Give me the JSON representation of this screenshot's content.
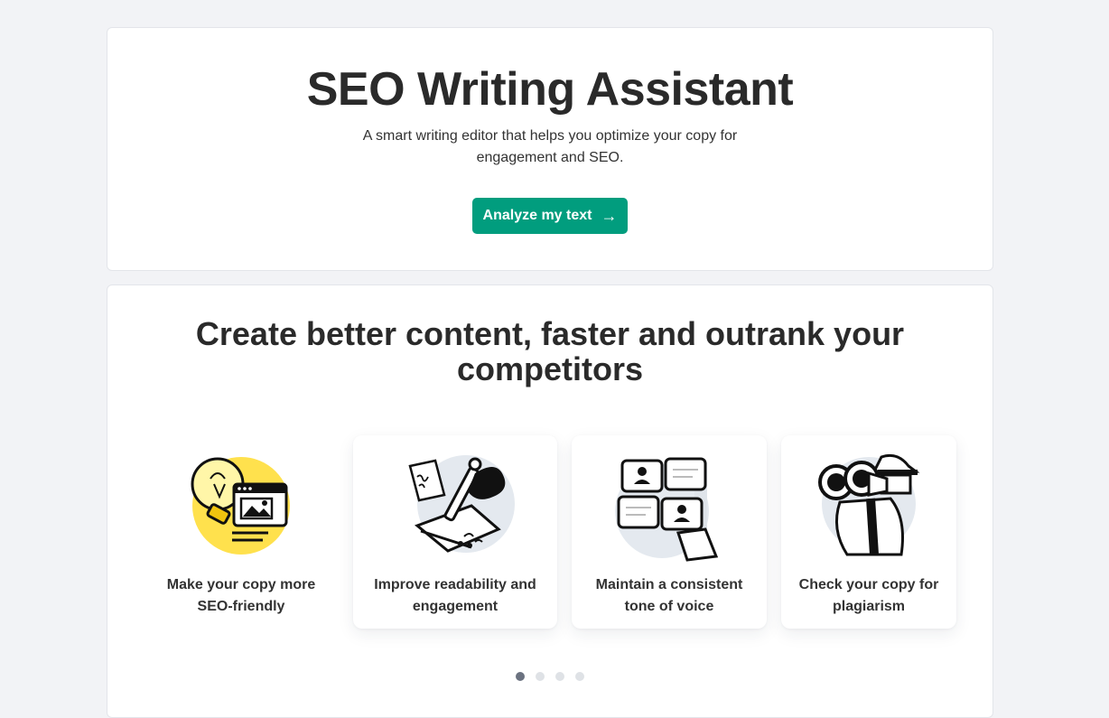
{
  "hero": {
    "title": "SEO Writing Assistant",
    "subtitle": "A smart writing editor that helps you optimize your copy for engagement and SEO.",
    "cta_label": "Analyze my text",
    "cta_icon": "arrow-right-icon",
    "cta_color": "#019d7e"
  },
  "features": {
    "heading": "Create better content, faster and outrank your competitors",
    "items": [
      {
        "label": "Make your copy more SEO-friendly",
        "icon": "lightbulb-browser-icon",
        "accent": "#ffe14d"
      },
      {
        "label": "Improve readability and engagement",
        "icon": "hand-writing-icon",
        "accent": "#e4e9ef"
      },
      {
        "label": "Maintain a consistent tone of voice",
        "icon": "puzzle-pieces-icon",
        "accent": "#e4e9ef"
      },
      {
        "label": "Check your copy for plagiarism",
        "icon": "spy-binoculars-icon",
        "accent": "#e4e9ef"
      }
    ],
    "carousel": {
      "pages": 4,
      "active": 1
    }
  }
}
